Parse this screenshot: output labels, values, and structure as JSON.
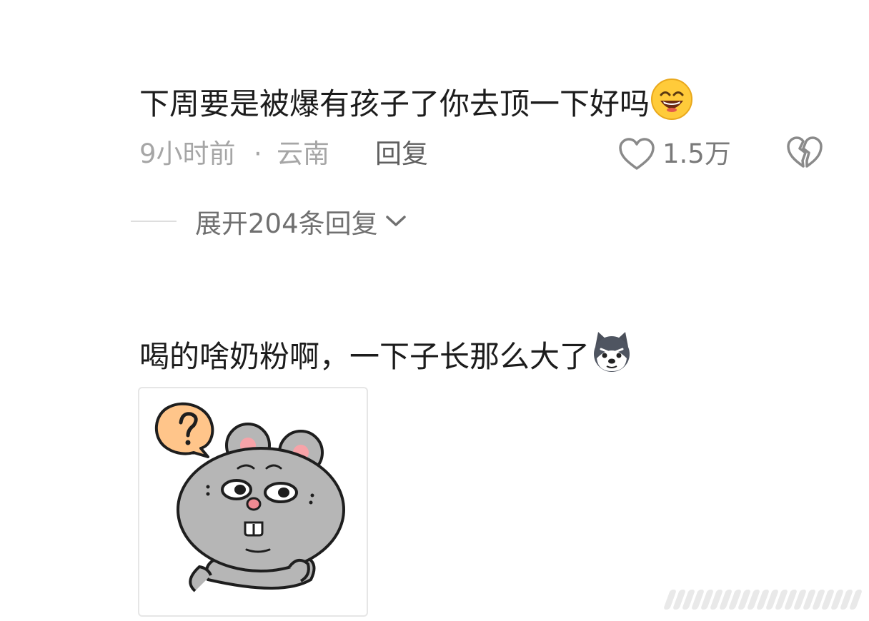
{
  "comments": [
    {
      "text": "下周要是被爆有孩子了你去顶一下好吗",
      "emoji": "grinning-face-emoji",
      "time": "9小时前",
      "separator": "·",
      "location": "云南",
      "reply_label": "回复",
      "like_count": "1.5万",
      "expand_label": "展开204条回复"
    },
    {
      "text": "喝的啥奶粉啊，一下子长那么大了",
      "emoji": "husky-dog-emoji",
      "sticker": "gray-mouse-question-sticker"
    }
  ],
  "colors": {
    "text_primary": "#1c1c1c",
    "text_meta": "#a6a6a6",
    "text_secondary": "#707070"
  }
}
